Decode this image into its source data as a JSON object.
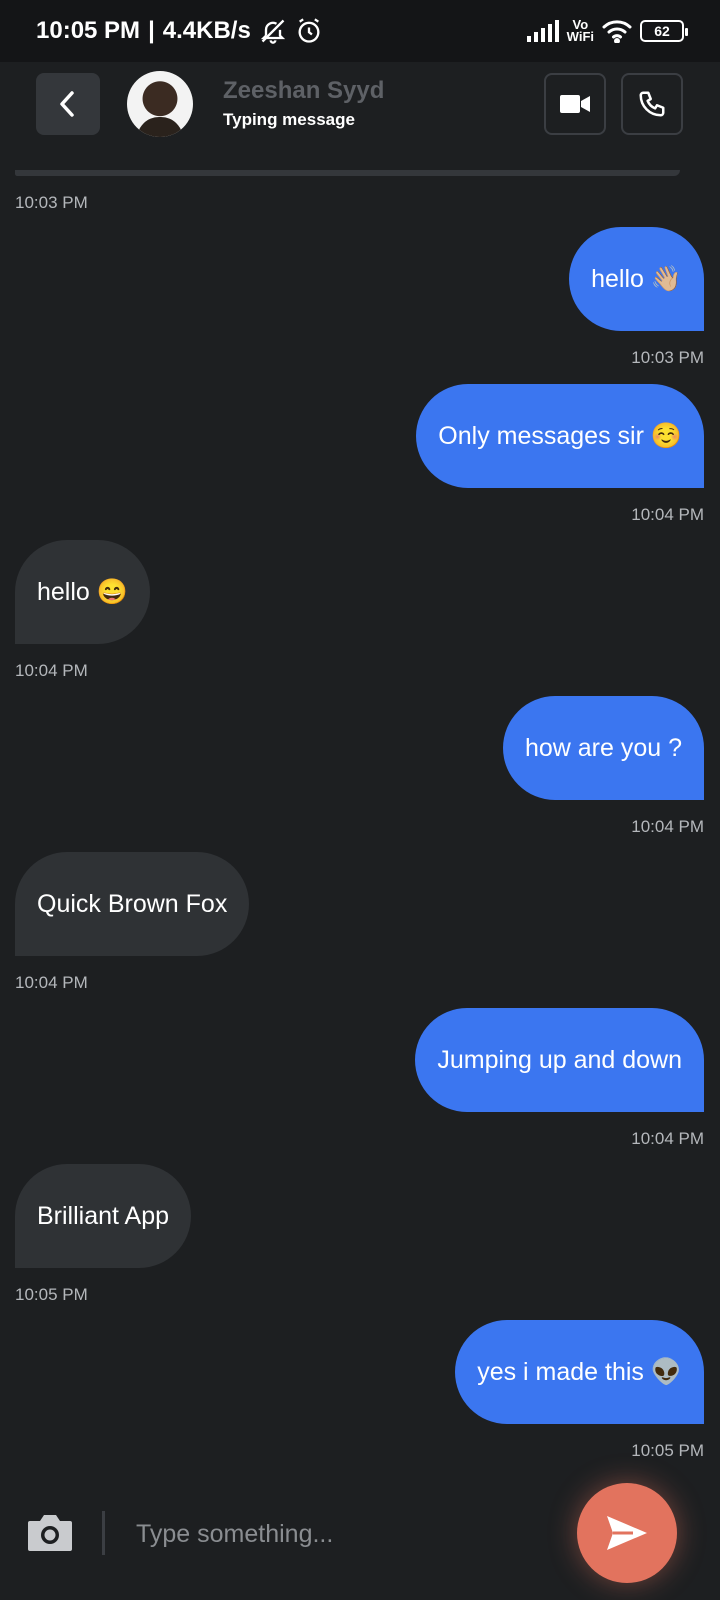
{
  "status_bar": {
    "time": "10:05 PM",
    "separator": "|",
    "net_speed": "4.4KB/s",
    "vowifi_top": "Vo",
    "vowifi_bottom": "WiFi",
    "battery": "62"
  },
  "header": {
    "contact_name": "Zeeshan Syyd",
    "contact_status": "Typing message"
  },
  "first_time": "10:03 PM",
  "messages": [
    {
      "side": "out",
      "text": "hello 👋🏼",
      "time": "10:03 PM"
    },
    {
      "side": "out",
      "text": "Only messages sir ☺️",
      "time": "10:04 PM"
    },
    {
      "side": "in",
      "text": "hello 😄",
      "time": "10:04 PM"
    },
    {
      "side": "out",
      "text": "how are you ?",
      "time": "10:04 PM"
    },
    {
      "side": "in",
      "text": "Quick Brown Fox",
      "time": "10:04 PM"
    },
    {
      "side": "out",
      "text": "Jumping up and down",
      "time": "10:04 PM"
    },
    {
      "side": "in",
      "text": "Brilliant App",
      "time": "10:05 PM"
    },
    {
      "side": "out",
      "text": "yes i made this 👽",
      "time": "10:05 PM"
    }
  ],
  "composer": {
    "value": "",
    "placeholder": "Type something..."
  },
  "colors": {
    "background": "#1d1f21",
    "outgoing_bubble": "#3b76f0",
    "incoming_bubble": "#2f3235",
    "send_button": "#e2735e"
  },
  "icons": {
    "back": "chevron-left-icon",
    "video": "video-camera-icon",
    "voice": "phone-icon",
    "camera": "camera-icon",
    "send": "send-icon"
  }
}
